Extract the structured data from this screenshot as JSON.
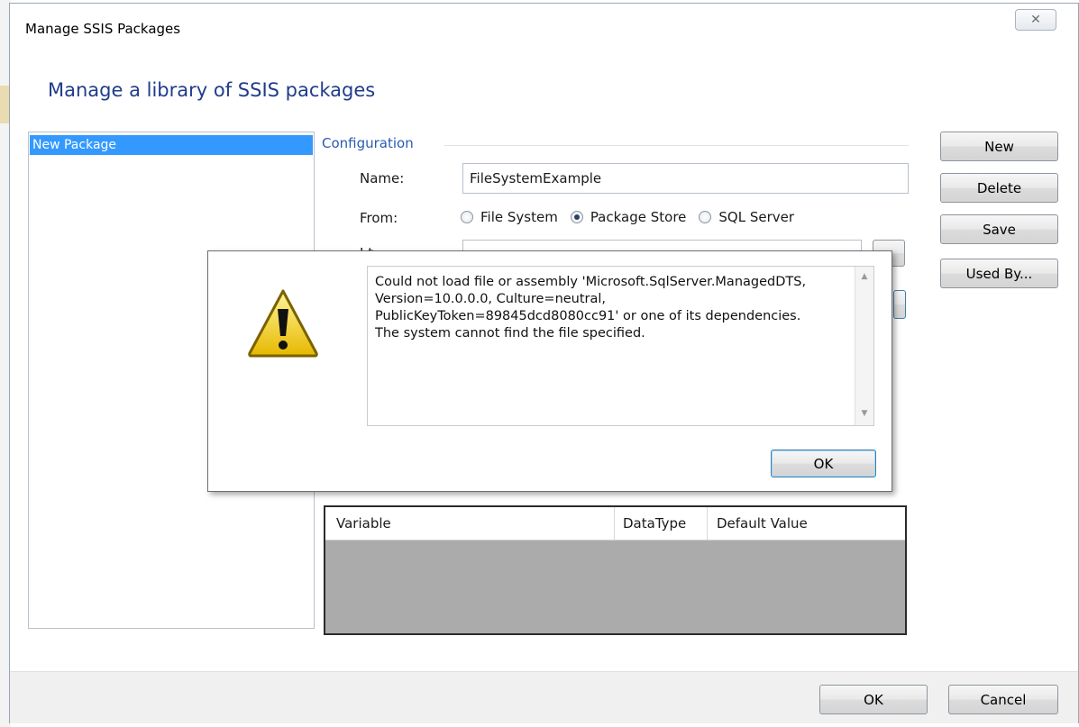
{
  "window": {
    "title": "Manage SSIS Packages",
    "close_glyph": "✕",
    "header_title": "Manage a library of SSIS packages"
  },
  "packages": {
    "items": [
      {
        "label": "New Package",
        "selected": true
      }
    ]
  },
  "configuration": {
    "section_label": "Configuration",
    "name_label": "Name:",
    "name_value": "FileSystemExample",
    "from_label": "From:",
    "from_options": [
      {
        "label": "File System",
        "selected": false
      },
      {
        "label": "Package Store",
        "selected": true
      },
      {
        "label": "SQL Server",
        "selected": false
      }
    ],
    "instance_label_partial": "I  t"
  },
  "buttons": {
    "new": "New",
    "delete": "Delete",
    "save": "Save",
    "used_by": "Used By..."
  },
  "grid": {
    "columns": [
      "Variable",
      "DataType",
      "Default Value"
    ]
  },
  "footer": {
    "ok": "OK",
    "cancel": "Cancel"
  },
  "error_dialog": {
    "icon": "warning-icon",
    "message": "Could not load file or assembly 'Microsoft.SqlServer.ManagedDTS,\nVersion=10.0.0.0, Culture=neutral,\nPublicKeyToken=89845dcd8080cc91' or one of its dependencies.\nThe system cannot find the file specified.",
    "ok": "OK"
  },
  "colors": {
    "accent_title": "#1f3c8a",
    "selection": "#3399ff",
    "section_label": "#2a5bb0",
    "grid_background": "#ababab"
  }
}
